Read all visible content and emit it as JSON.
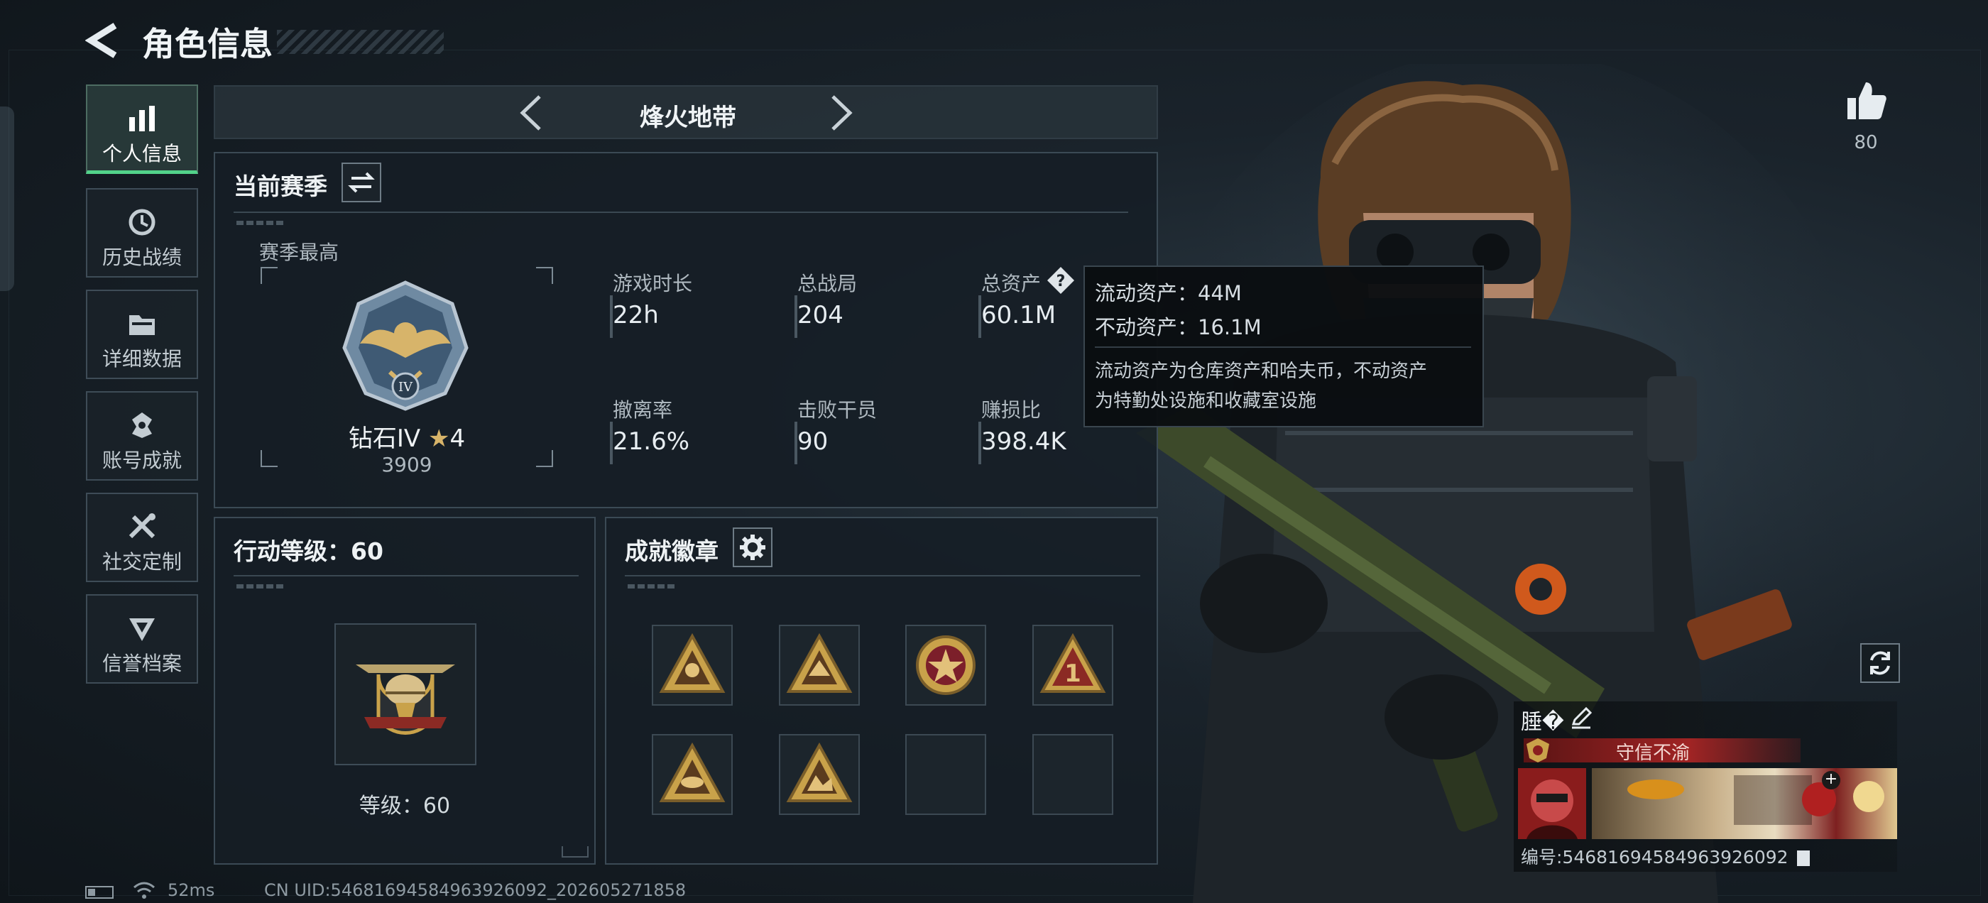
{
  "header": {
    "title": "角色信息"
  },
  "sidebar": {
    "items": [
      {
        "label": "个人信息",
        "icon": "bar-chart-icon",
        "active": true
      },
      {
        "label": "历史战绩",
        "icon": "history-clock-icon",
        "active": false
      },
      {
        "label": "详细数据",
        "icon": "folder-icon",
        "active": false
      },
      {
        "label": "账号成就",
        "icon": "achievement-icon",
        "active": false
      },
      {
        "label": "社交定制",
        "icon": "tools-icon",
        "active": false
      },
      {
        "label": "信誉档案",
        "icon": "reputation-icon",
        "active": false
      }
    ]
  },
  "mode_switcher": {
    "title": "烽火地带"
  },
  "season": {
    "title": "当前赛季",
    "best_label": "赛季最高",
    "rank_name": "钻石IV",
    "rank_stars": "4",
    "rank_score": "3909",
    "stats": [
      {
        "label": "游戏时长",
        "value": "22h"
      },
      {
        "label": "总战局",
        "value": "204"
      },
      {
        "label": "总资产",
        "value": "60.1M"
      },
      {
        "label": "撤离率",
        "value": "21.6%"
      },
      {
        "label": "击败干员",
        "value": "90"
      },
      {
        "label": "赚损比",
        "value": "398.4K"
      }
    ]
  },
  "tooltip": {
    "liquid": "流动资产：44M",
    "fixed": "不动资产：16.1M",
    "note_line1": "流动资产为仓库资产和哈夫币，不动资产",
    "note_line2": "为特勤处设施和收藏室设施"
  },
  "action_level": {
    "title": "行动等级：60",
    "level_text": "等级：60"
  },
  "badges": {
    "title": "成就徽章",
    "filled_count": 6,
    "total_slots": 8
  },
  "likes": {
    "count": "80"
  },
  "player_card": {
    "name": "腄�",
    "reputation_title": "守信不渝",
    "id_text": "编号:54681694584963926092"
  },
  "footer": {
    "ping": "52ms",
    "uid": "CN UID:54681694584963926092_202605271858"
  },
  "colors": {
    "accent_green": "#52d38a",
    "reputation_red": "#8a1f1f",
    "badge_gold": "#c9a24a"
  }
}
